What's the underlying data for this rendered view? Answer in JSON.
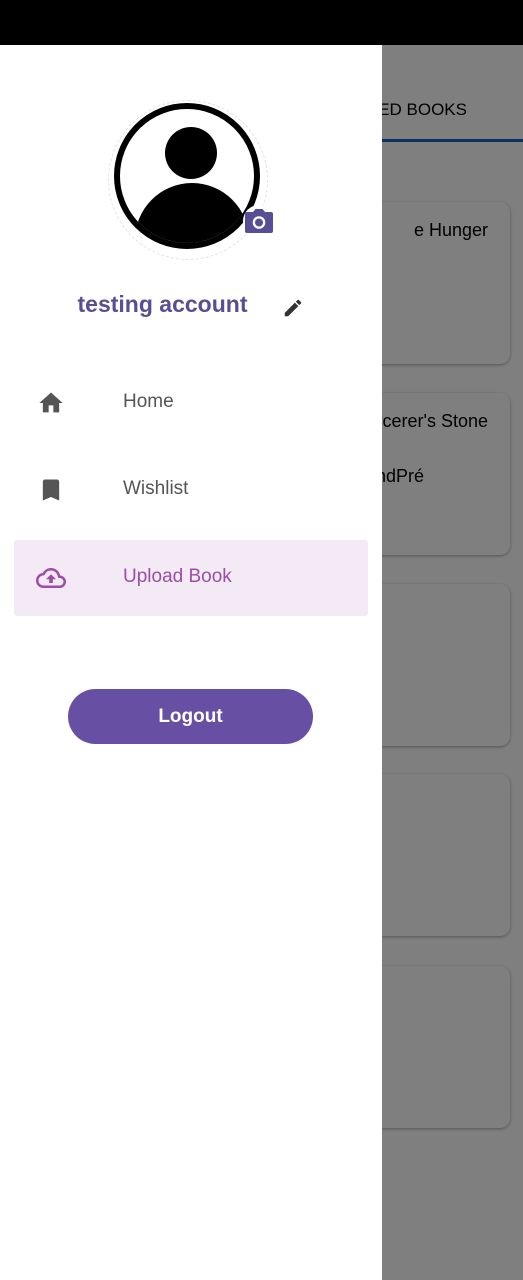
{
  "background": {
    "tab_label": "ED BOOKS",
    "cards": [
      {
        "line1": "e Hunger",
        "line2": ""
      },
      {
        "line1": "rcerer's Stone",
        "line2": "ndPré"
      },
      {
        "line1": "",
        "line2": ""
      },
      {
        "line1": "",
        "line2": ""
      },
      {
        "line1": "",
        "line2": ""
      }
    ]
  },
  "drawer": {
    "user_name": "testing account",
    "menu": [
      {
        "label": "Home",
        "icon": "home-icon",
        "selected": false
      },
      {
        "label": "Wishlist",
        "icon": "bookmark-icon",
        "selected": false
      },
      {
        "label": "Upload Book",
        "icon": "cloud-upload-icon",
        "selected": true
      }
    ],
    "logout_label": "Logout"
  },
  "colors": {
    "accent": "#584e96",
    "logout_button": "#6750a4",
    "selected_item_bg": "#f3eaf5",
    "selected_item_text": "#9c4da8",
    "camera_icon": "#584e96",
    "tab_indicator": "#1565c0"
  }
}
